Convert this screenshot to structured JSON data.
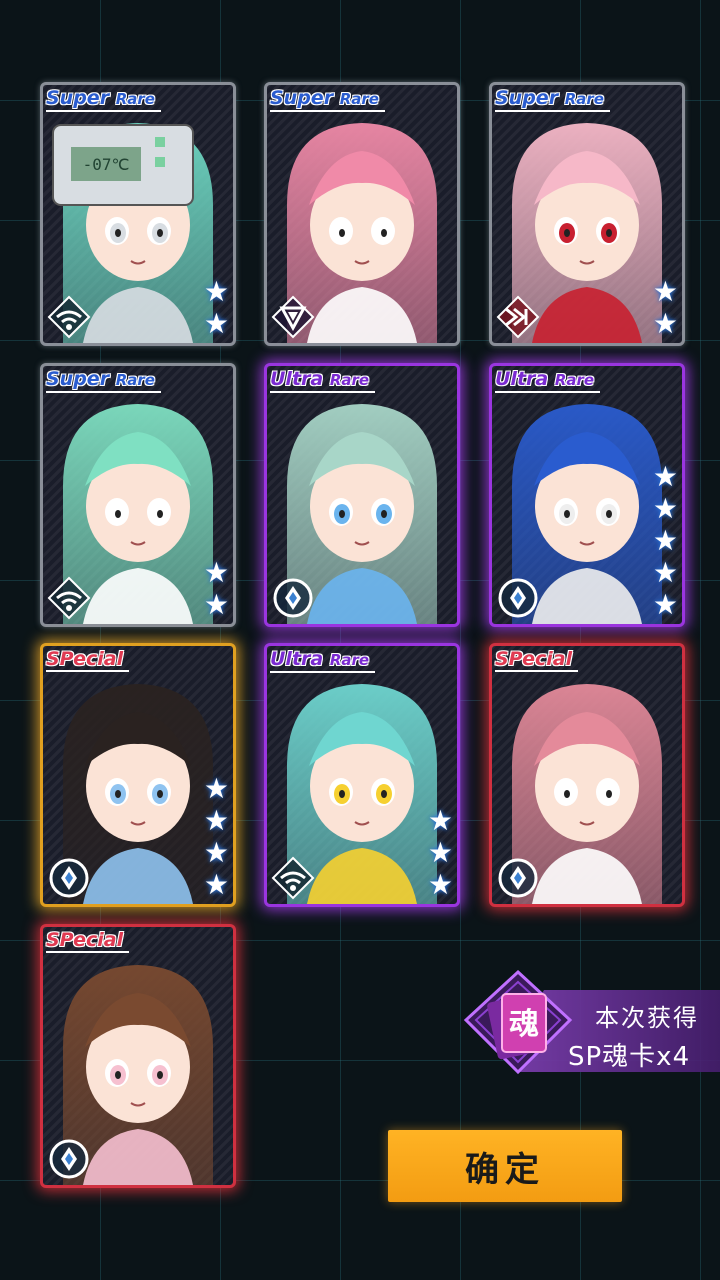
{
  "cards": [
    {
      "rarity_main": "Super",
      "rarity_sub": "Rare",
      "tier": "sr",
      "stars": 2,
      "emblem": "wifi-emblem-icon",
      "art_label": "-07℃",
      "hair": "#6fd9c4",
      "accent": "#d8dde2"
    },
    {
      "rarity_main": "Super",
      "rarity_sub": "Rare",
      "tier": "sr",
      "stars": 0,
      "emblem": "triangle-emblem-icon",
      "art_label": "",
      "hair": "#f08aa8",
      "accent": "#ffffff"
    },
    {
      "rarity_main": "Super",
      "rarity_sub": "Rare",
      "tier": "sr",
      "stars": 2,
      "emblem": "stripes-emblem-icon",
      "art_label": "",
      "hair": "#f6b8c8",
      "accent": "#c82030"
    },
    {
      "rarity_main": "Super",
      "rarity_sub": "Rare",
      "tier": "sr",
      "stars": 2,
      "emblem": "wifi-emblem-icon",
      "art_label": "",
      "hair": "#7fe0c2",
      "accent": "#ffffff"
    },
    {
      "rarity_main": "Ultra",
      "rarity_sub": "Rare",
      "tier": "ur",
      "stars": 0,
      "emblem": "diamond-emblem-icon",
      "art_label": "",
      "hair": "#a8d6c8",
      "accent": "#6ab4ee"
    },
    {
      "rarity_main": "Ultra",
      "rarity_sub": "Rare",
      "tier": "ur",
      "stars": 5,
      "emblem": "diamond-emblem-icon",
      "art_label": "",
      "hair": "#2a5ccf",
      "accent": "#eeeeee"
    },
    {
      "rarity_main": "SPecial",
      "rarity_sub": "",
      "tier": "sp-gold",
      "stars": 4,
      "emblem": "diamond-emblem-icon",
      "art_label": "",
      "hair": "#2a2220",
      "accent": "#8fc3f0"
    },
    {
      "rarity_main": "Ultra",
      "rarity_sub": "Rare",
      "tier": "ur",
      "stars": 3,
      "emblem": "wifi-emblem-icon",
      "art_label": "",
      "hair": "#6fd6d0",
      "accent": "#f6d030"
    },
    {
      "rarity_main": "SPecial",
      "rarity_sub": "",
      "tier": "sp-red",
      "stars": 0,
      "emblem": "diamond-emblem-icon",
      "art_label": "",
      "hair": "#e48a9a",
      "accent": "#ffffff"
    },
    {
      "rarity_main": "SPecial",
      "rarity_sub": "",
      "tier": "sp-red",
      "stars": 0,
      "emblem": "diamond-emblem-icon",
      "art_label": "",
      "hair": "#7a4a30",
      "accent": "#f6c0d0"
    }
  ],
  "reward": {
    "gem_char": "魂",
    "title": "本次获得",
    "amount": "SP魂卡x4"
  },
  "confirm_label": "确定"
}
